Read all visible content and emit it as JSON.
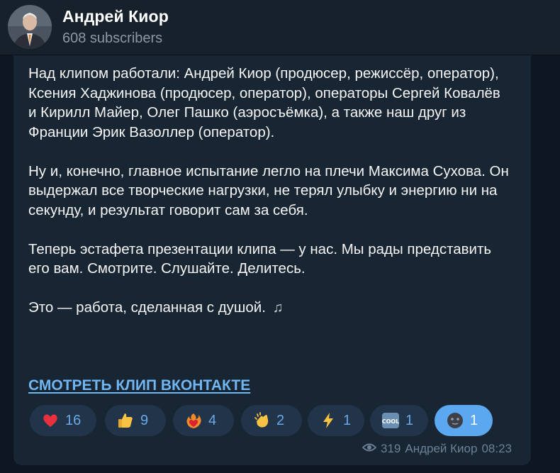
{
  "header": {
    "channel_name": "Андрей Киор",
    "subscribers": "608 subscribers"
  },
  "message": {
    "paragraphs": [
      "Над клипом работали: Андрей Киор (продюсер, режиссёр, оператор), Ксения Хаджинова (продюсер, оператор), операторы Сергей Ковалёв и Кирилл Майер, Олег Пашко (аэросъёмка), а также наш друг из Франции Эрик Вазоллер (оператор).",
      "Ну и, конечно, главное испытание легло на плечи Максима Сухова. Он выдержал все творческие нагрузки, не терял улыбку и энергию ни на секунду, и результат говорит сам за себя.",
      "Теперь эстафета презентации клипа — у нас. Мы рады представить его вам. Смотрите. Слушайте. Делитесь.",
      "Это — работа, сделанная с душой."
    ],
    "note_icon": "music-notes-icon",
    "link_text": "СМОТРЕТЬ КЛИП ВКОНТАКТЕ"
  },
  "reactions": [
    {
      "icon": "red-heart-icon",
      "count": "16"
    },
    {
      "icon": "thumbs-up-icon",
      "count": "9"
    },
    {
      "icon": "heart-on-fire-icon",
      "count": "4"
    },
    {
      "icon": "clapping-hands-icon",
      "count": "2"
    },
    {
      "icon": "lightning-icon",
      "count": "1"
    },
    {
      "icon": "cool-button-icon",
      "count": "1"
    },
    {
      "icon": "new-moon-face-icon",
      "count": "1"
    }
  ],
  "footer": {
    "views": "319",
    "author": "Андрей Киор",
    "time": "08:23"
  },
  "colors": {
    "background": "#0e1621",
    "header": "#17212b",
    "bubble": "#182533",
    "link": "#71b5f1",
    "reaction_bg": "#223449",
    "reaction_active": "#5ba8f0"
  }
}
